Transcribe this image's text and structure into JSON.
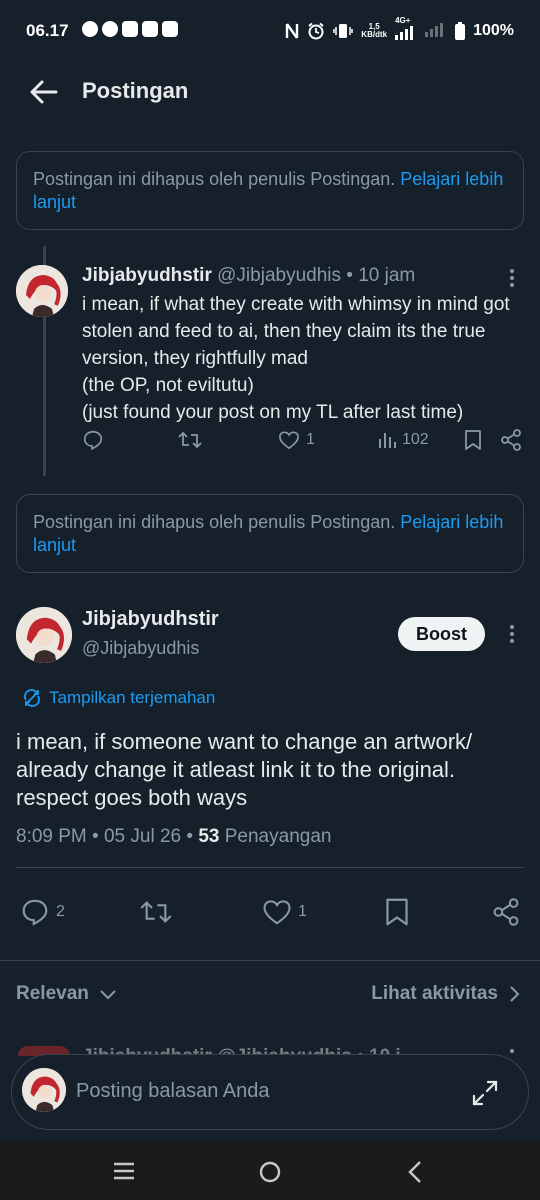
{
  "status_bar": {
    "time": "06.17",
    "net_rate_top": "1,5",
    "net_rate_bottom": "KB/dtk",
    "network_type": "4G+",
    "battery": "100%"
  },
  "header": {
    "title": "Postingan"
  },
  "deleted_notice": {
    "text": "Postingan ini dihapus oleh penulis Postingan. ",
    "link": "Pelajari lebih lanjut"
  },
  "reply_post": {
    "name": "Jibjabyudhstir",
    "handle": "@Jibjabyudhis",
    "separator": " • ",
    "time": "10 jam",
    "lines": [
      "i mean, if what they create with whimsy in mind got stolen and feed to ai, then they claim its the true version, they rightfully mad",
      "(the OP, not eviltutu)",
      "(just found your post on my TL after last time)"
    ],
    "likes": "1",
    "views": "102"
  },
  "main_post": {
    "name": "Jibjabyudhstir",
    "handle": "@Jibjabyudhis",
    "boost_label": "Boost",
    "translate_label": "Tampilkan terjemahan",
    "text": "i mean, if someone want to change an artwork/ already change it atleast link it to the original. respect goes both ways",
    "time": "8:09 PM",
    "date": "05 Jul 26",
    "dot": " • ",
    "views_count": "53",
    "views_label": " Penayangan",
    "replies": "2",
    "likes": "1"
  },
  "sort": {
    "label": "Relevan",
    "activity_label": "Lihat aktivitas"
  },
  "peek_reply": {
    "text": "Jibjabyudhstir @Jibjabyudhis • 10 j"
  },
  "compose": {
    "placeholder": "Posting balasan Anda"
  },
  "colors": {
    "background": "#15202b",
    "text": "#e7e9ea",
    "muted": "#8b98a5",
    "accent": "#1d9bf0",
    "border": "#38444d"
  },
  "icons": [
    "whatsapp-icon",
    "message-icon",
    "app-icon",
    "mail-icon",
    "store-icon",
    "nfc-icon",
    "alarm-icon",
    "vibrate-icon",
    "signal-icon",
    "battery-icon",
    "back-arrow-icon",
    "reply-icon",
    "repost-icon",
    "like-icon",
    "views-icon",
    "bookmark-icon",
    "share-icon",
    "translate-icon",
    "chevron-down-icon",
    "chevron-right-icon",
    "expand-icon",
    "more-icon"
  ]
}
